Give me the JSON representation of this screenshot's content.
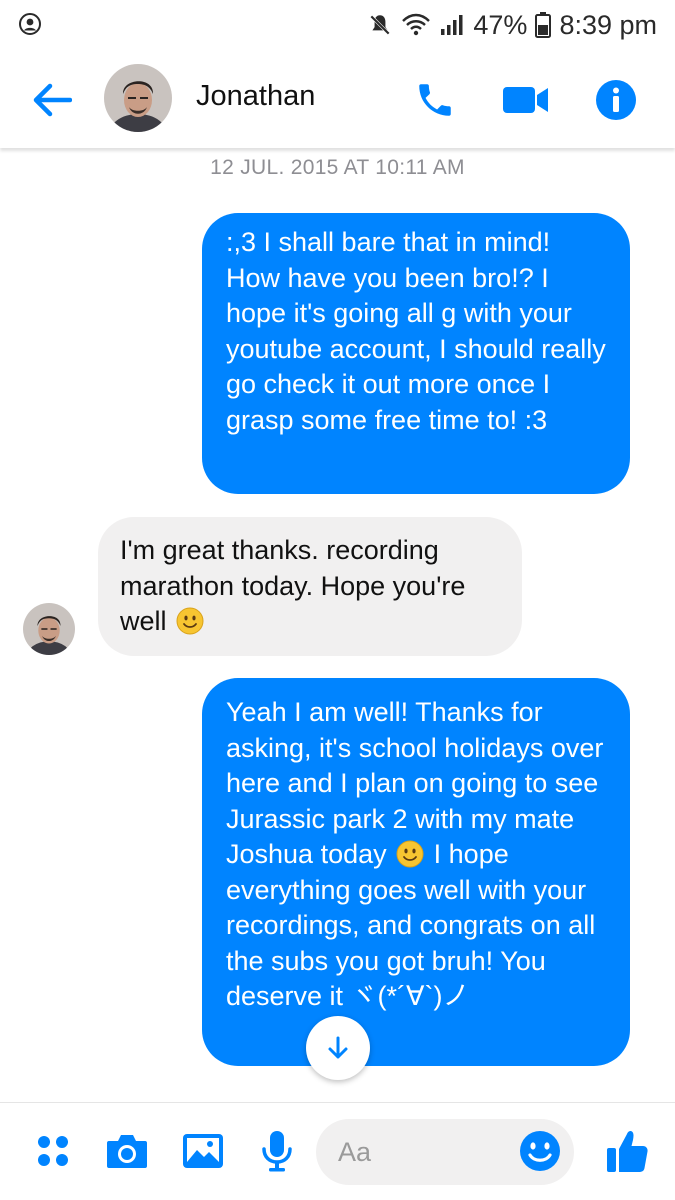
{
  "status_bar": {
    "battery": "47%",
    "time": "8:39 pm",
    "icons": [
      "account-circle-icon",
      "mute-icon",
      "wifi-icon",
      "signal-icon",
      "battery-icon"
    ]
  },
  "header": {
    "contact_name": "Jonathan",
    "icons": [
      "back-arrow-icon",
      "phone-icon",
      "video-call-icon",
      "info-icon"
    ]
  },
  "conversation": {
    "timestamp": "12 JUL. 2015 AT 10:11 AM",
    "messages": [
      {
        "direction": "outgoing",
        "text": ":,3 I shall bare that in mind! How have you been bro!? I hope it's going all g with your youtube account, I should really go check it out more once I grasp some free time to! :3"
      },
      {
        "direction": "incoming",
        "text_before_emoji": "I'm great thanks. recording marathon today. Hope you're well",
        "text_after_emoji": ""
      },
      {
        "direction": "outgoing",
        "text_before_emoji": "Yeah I am well! Thanks for asking, it's school holidays over here and I plan on going to see Jurassic park 2 with my mate Joshua today",
        "text_after_emoji": "I hope everything goes well with your recordings, and congrats on all the subs you got bruh! You deserve it ヾ(*´∀`)ノ"
      }
    ]
  },
  "composer": {
    "placeholder": "Aa",
    "icons": [
      "more-apps-icon",
      "camera-icon",
      "gallery-icon",
      "microphone-icon",
      "emoji-icon",
      "thumbs-up-icon"
    ]
  },
  "colors": {
    "accent": "#0084ff",
    "incoming_bubble": "#f1f0f0",
    "timestamp": "#8e8e93"
  }
}
